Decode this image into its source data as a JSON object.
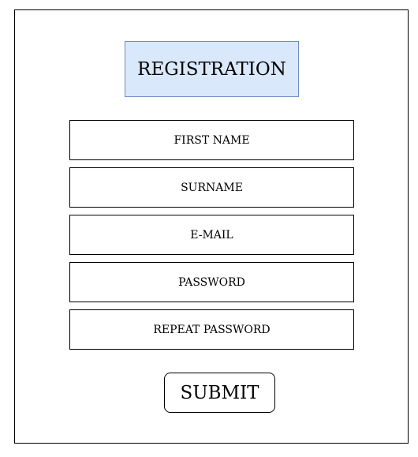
{
  "form": {
    "title": "REGISTRATION",
    "title_bg": "#dae8fc",
    "title_border": "#6c8ebf",
    "fields": [
      {
        "label": "FIRST NAME"
      },
      {
        "label": "SURNAME"
      },
      {
        "label": "E-MAIL"
      },
      {
        "label": "PASSWORD"
      },
      {
        "label": "REPEAT PASSWORD"
      }
    ],
    "submit_label": "SUBMIT"
  }
}
